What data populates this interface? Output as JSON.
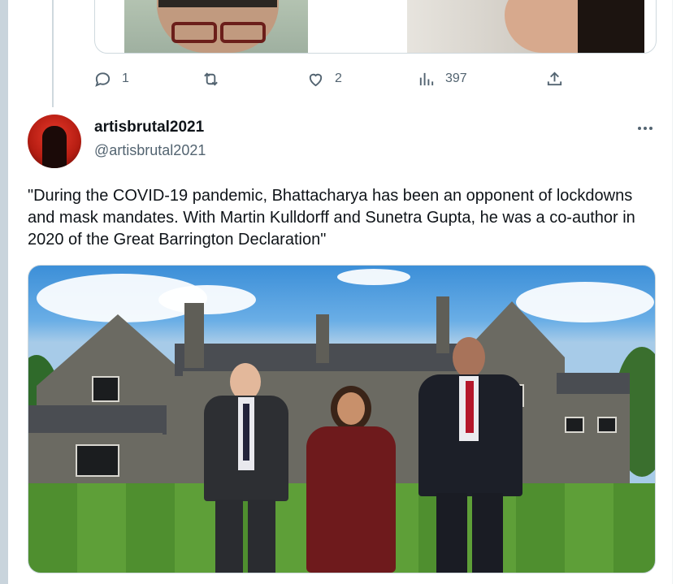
{
  "previous_tweet": {
    "actions": {
      "reply_count": "1",
      "retweet_count": "",
      "like_count": "2",
      "views_count": "397"
    }
  },
  "tweet": {
    "display_name": "artisbrutal2021",
    "handle": "@artisbrutal2021",
    "text": "\"During the COVID-19 pandemic, Bhattacharya has been an opponent of lockdowns and mask mandates. With Martin Kulldorff and Sunetra Gupta, he was a co-author in 2020 of the Great Barrington Declaration\""
  },
  "colors": {
    "text_primary": "#0f1419",
    "text_secondary": "#536471",
    "border": "#cfd9de",
    "left_rail": "#c9d4dc"
  },
  "icons": {
    "reply": "reply-icon",
    "retweet": "retweet-icon",
    "like": "like-icon",
    "views": "views-icon",
    "share": "share-icon",
    "more": "more-icon"
  }
}
